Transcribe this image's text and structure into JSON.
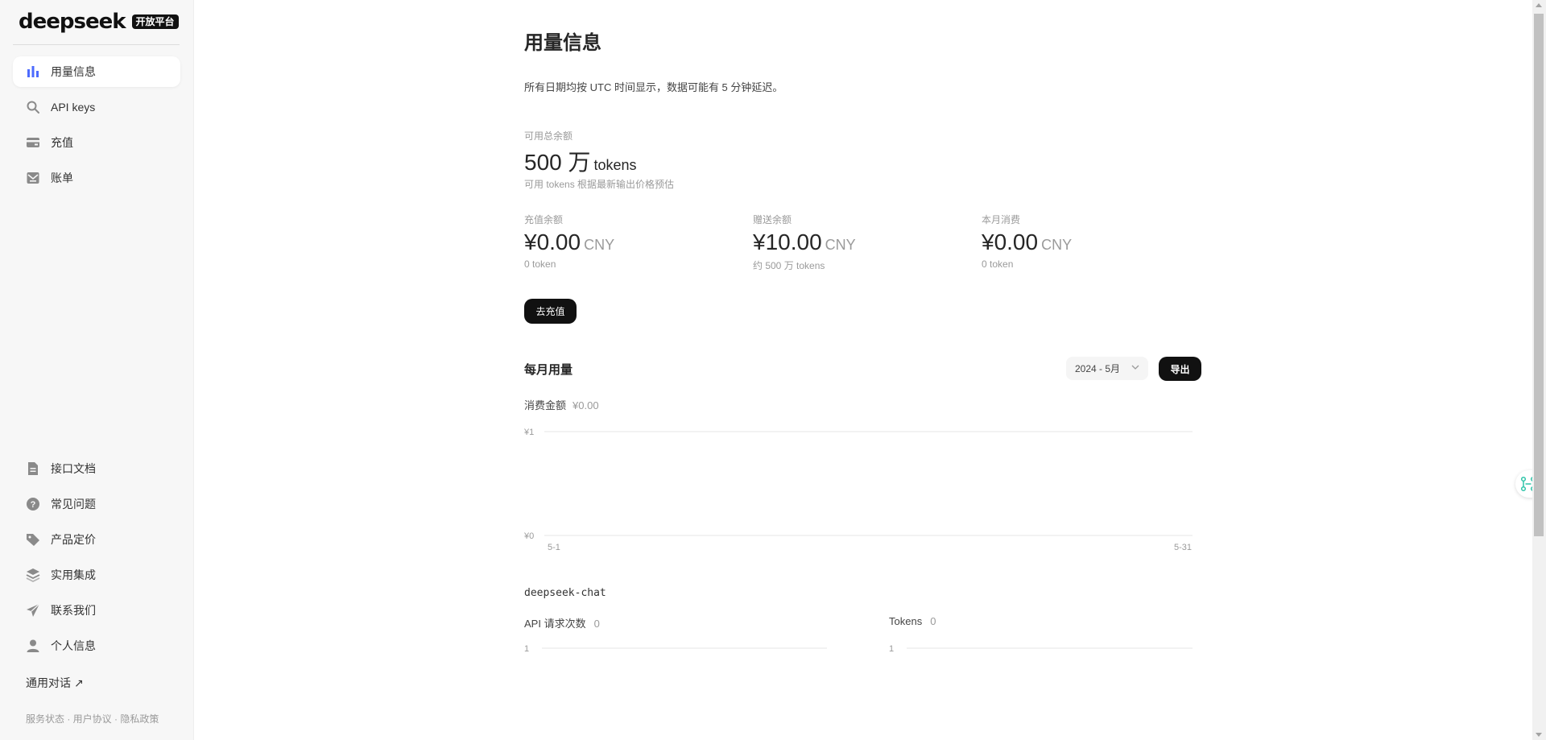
{
  "brand": {
    "name": "deepseek",
    "badge": "开放平台"
  },
  "sidebar": {
    "top_items": [
      {
        "label": "用量信息",
        "icon": "bar-chart-icon",
        "active": true
      },
      {
        "label": "API keys",
        "icon": "search-icon",
        "active": false
      },
      {
        "label": "充值",
        "icon": "wallet-icon",
        "active": false
      },
      {
        "label": "账单",
        "icon": "bill-icon",
        "active": false
      }
    ],
    "bottom_items": [
      {
        "label": "接口文档",
        "icon": "document-icon"
      },
      {
        "label": "常见问题",
        "icon": "question-icon"
      },
      {
        "label": "产品定价",
        "icon": "tag-icon"
      },
      {
        "label": "实用集成",
        "icon": "layers-icon"
      },
      {
        "label": "联系我们",
        "icon": "send-icon"
      },
      {
        "label": "个人信息",
        "icon": "user-icon"
      }
    ],
    "chat_link": "通用对话",
    "footer": "服务状态 · 用户协议 · 隐私政策"
  },
  "main": {
    "title": "用量信息",
    "notice": "所有日期均按 UTC 时间显示，数据可能有 5 分钟延迟。",
    "total": {
      "label": "可用总余额",
      "value": "500 万",
      "unit": "tokens",
      "note": "可用 tokens 根据最新输出价格预估"
    },
    "balances": [
      {
        "label": "充值余额",
        "amount": "¥0.00",
        "currency": "CNY",
        "sub": "0 token"
      },
      {
        "label": "赠送余额",
        "amount": "¥10.00",
        "currency": "CNY",
        "sub": "约 500 万 tokens"
      },
      {
        "label": "本月消费",
        "amount": "¥0.00",
        "currency": "CNY",
        "sub": "0 token"
      }
    ],
    "topup_button": "去充值",
    "monthly": {
      "title": "每月用量",
      "month_selected": "2024 - 5月",
      "export_button": "导出",
      "spend_label": "消费金额",
      "spend_value": "¥0.00"
    },
    "model": {
      "name": "deepseek-chat",
      "requests_label": "API 请求次数",
      "requests_value": "0",
      "tokens_label": "Tokens",
      "tokens_value": "0"
    }
  },
  "chart_data": [
    {
      "type": "line",
      "ylabel": "",
      "y_tick_labels": [
        "¥1",
        "¥0"
      ],
      "x_tick_labels": [
        "5-1",
        "5-31"
      ],
      "ylim": [
        0,
        1
      ],
      "series": [
        {
          "values": []
        }
      ]
    },
    {
      "type": "line",
      "y_tick_labels": [
        "1"
      ],
      "series": [
        {
          "values": []
        }
      ]
    },
    {
      "type": "line",
      "y_tick_labels": [
        "1"
      ],
      "series": [
        {
          "values": []
        }
      ]
    }
  ],
  "colors": {
    "accent": "#4d6bfe",
    "dark_button": "#111111",
    "muted_text": "#9a9a9a",
    "widget": "#2ec4a8"
  }
}
